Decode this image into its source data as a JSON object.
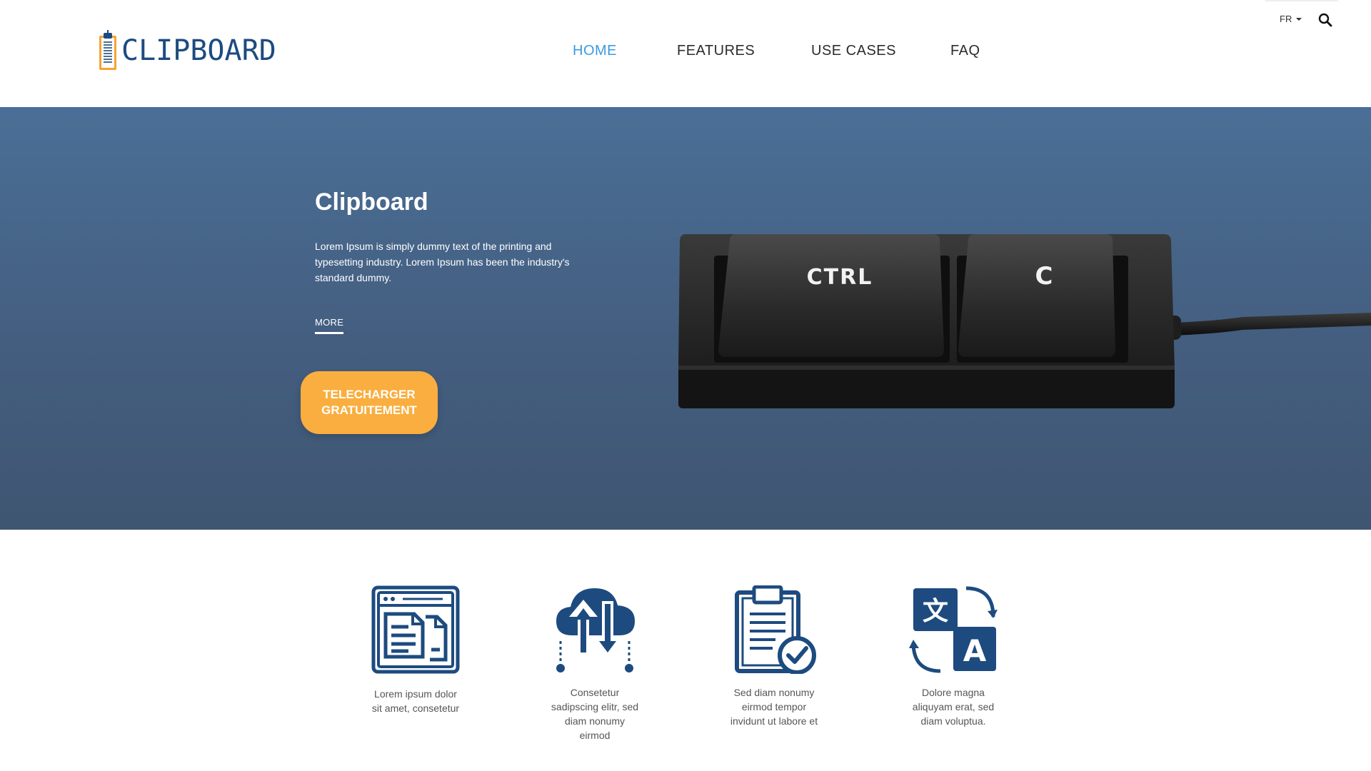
{
  "brand": {
    "logo_text": "CLIPBOARD",
    "primary_color": "#1d4b7f",
    "accent_color": "#f9ae3f",
    "nav_active_color": "#3a9be0"
  },
  "nav": {
    "items": [
      {
        "label": "HOME",
        "active": true
      },
      {
        "label": "FEATURES",
        "active": false
      },
      {
        "label": "USE CASES",
        "active": false
      },
      {
        "label": "FAQ",
        "active": false
      }
    ]
  },
  "utility": {
    "language": "FR",
    "search_icon": "search-icon"
  },
  "hero": {
    "title": "Clipboard",
    "description": "Lorem Ipsum is simply dummy text of the printing and typesetting industry. Lorem Ipsum has been the industry's standard dummy.",
    "more_link": "MORE",
    "cta_line1": "TELECHARGER",
    "cta_line2": "GRATUITEMENT",
    "keyboard_key1": "CTRL",
    "keyboard_key2": "C"
  },
  "features": [
    {
      "icon": "browser-documents-icon",
      "text": "Lorem ipsum dolor sit amet, consetetur"
    },
    {
      "icon": "cloud-transfer-icon",
      "text": "Consetetur sadipscing elitr, sed diam nonumy eirmod"
    },
    {
      "icon": "clipboard-check-icon",
      "text": "Sed diam nonumy eirmod tempor invidunt ut labore et"
    },
    {
      "icon": "translate-icon",
      "text": "Dolore magna aliquyam erat, sed diam voluptua."
    }
  ]
}
